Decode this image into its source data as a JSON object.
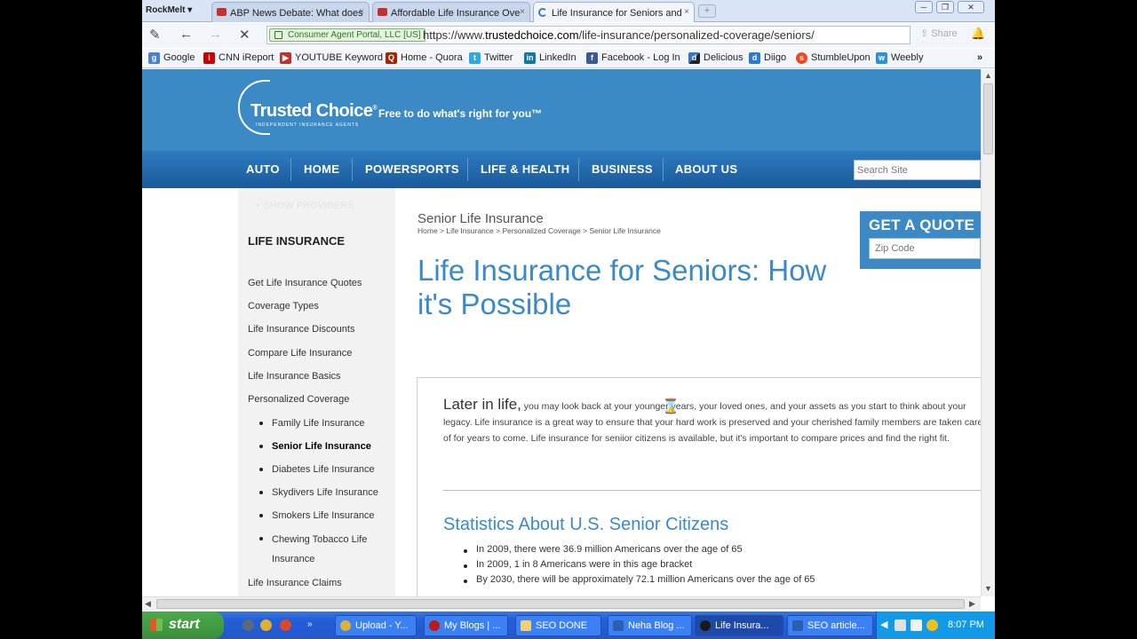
{
  "browser": {
    "app_name": "RockMelt ▾",
    "tabs": [
      {
        "label": "ABP News Debate: What does",
        "close": "×"
      },
      {
        "label": "Affordable Life Insurance Ove",
        "close": "×"
      },
      {
        "label": "Life Insurance for Seniors and",
        "close": "×"
      }
    ],
    "new_tab": "+",
    "window_buttons": [
      "─",
      "❐",
      "✕"
    ],
    "ev_cert": "Consumer Agent Portal, LLC [US]",
    "url_scheme": "https://www.",
    "url_host": "trustedchoice.com",
    "url_path": "/life-insurance/personalized-coverage/seniors/",
    "share_label": "Share"
  },
  "bookmarks": [
    {
      "label": "Google",
      "icon": "g"
    },
    {
      "label": "CNN iReport",
      "icon": "i"
    },
    {
      "label": "YOUTUBE Keyword",
      "icon": "▶"
    },
    {
      "label": "Home - Quora",
      "icon": "Q"
    },
    {
      "label": "Twitter",
      "icon": "t"
    },
    {
      "label": "LinkedIn",
      "icon": "in"
    },
    {
      "label": "Facebook - Log In",
      "icon": "f"
    },
    {
      "label": "Delicious",
      "icon": "d"
    },
    {
      "label": "Diigo",
      "icon": "d"
    },
    {
      "label": "StumbleUpon",
      "icon": "s"
    },
    {
      "label": "Weebly",
      "icon": "w"
    }
  ],
  "bookmarks_more": "»",
  "site": {
    "brand": "Trusted Choice",
    "brand_mark": "®",
    "brand_sub": "INDEPENDENT INSURANCE AGENTS",
    "tagline": "Free to do what's right for you™",
    "nav": [
      "AUTO",
      "HOME",
      "POWERSPORTS",
      "LIFE & HEALTH",
      "BUSINESS",
      "ABOUT US"
    ],
    "search_placeholder": "Search Site"
  },
  "sidebar": {
    "faded_link": "+ SHOW PROVIDERS",
    "title": "LIFE INSURANCE",
    "links": [
      "Get Life Insurance Quotes",
      "Coverage Types",
      "Life Insurance Discounts",
      "Compare Life Insurance",
      "Life Insurance Basics",
      "Personalized Coverage"
    ],
    "sub_links": [
      "Family Life Insurance",
      "Senior Life Insurance",
      "Diabetes Life Insurance",
      "Skydivers Life Insurance",
      "Smokers Life Insurance",
      "Chewing Tobacco Life Insurance"
    ],
    "last_link": "Life Insurance Claims"
  },
  "main": {
    "section_title": "Senior Life Insurance",
    "breadcrumb": "Home > Life Insurance > Personalized Coverage > Senior Life Insurance",
    "heading": "Life Insurance for Seniors: How it's Possible",
    "intro_lead": "Later in life,",
    "intro_text": " you may look back at your younger years, your loved ones, and your assets as you start to think about your legacy. Life insurance is a great way to ensure that your hard work is preserved and your cherished family members are taken care of for years to come. Life insurance for seniior citizens is available, but it's important to compare prices and find the right fit.",
    "stats_heading": "Statistics About U.S. Senior Citizens",
    "stats": [
      "In 2009, there were 36.9 million Americans over the age of 65",
      "In 2009, 1 in 8 Americans were in this age bracket",
      "By 2030, there will be approximately 72.1 million Americans over the age of 65"
    ]
  },
  "quote": {
    "title": "GET A QUOTE",
    "zip_placeholder": "Zip Code"
  },
  "taskbar": {
    "start": "start",
    "tasks": [
      "Upload - Y...",
      "My Blogs | ...",
      "SEO DONE",
      "Neha Blog ...",
      "Life Insura...",
      "SEO article..."
    ],
    "clock": "8:07 PM"
  }
}
